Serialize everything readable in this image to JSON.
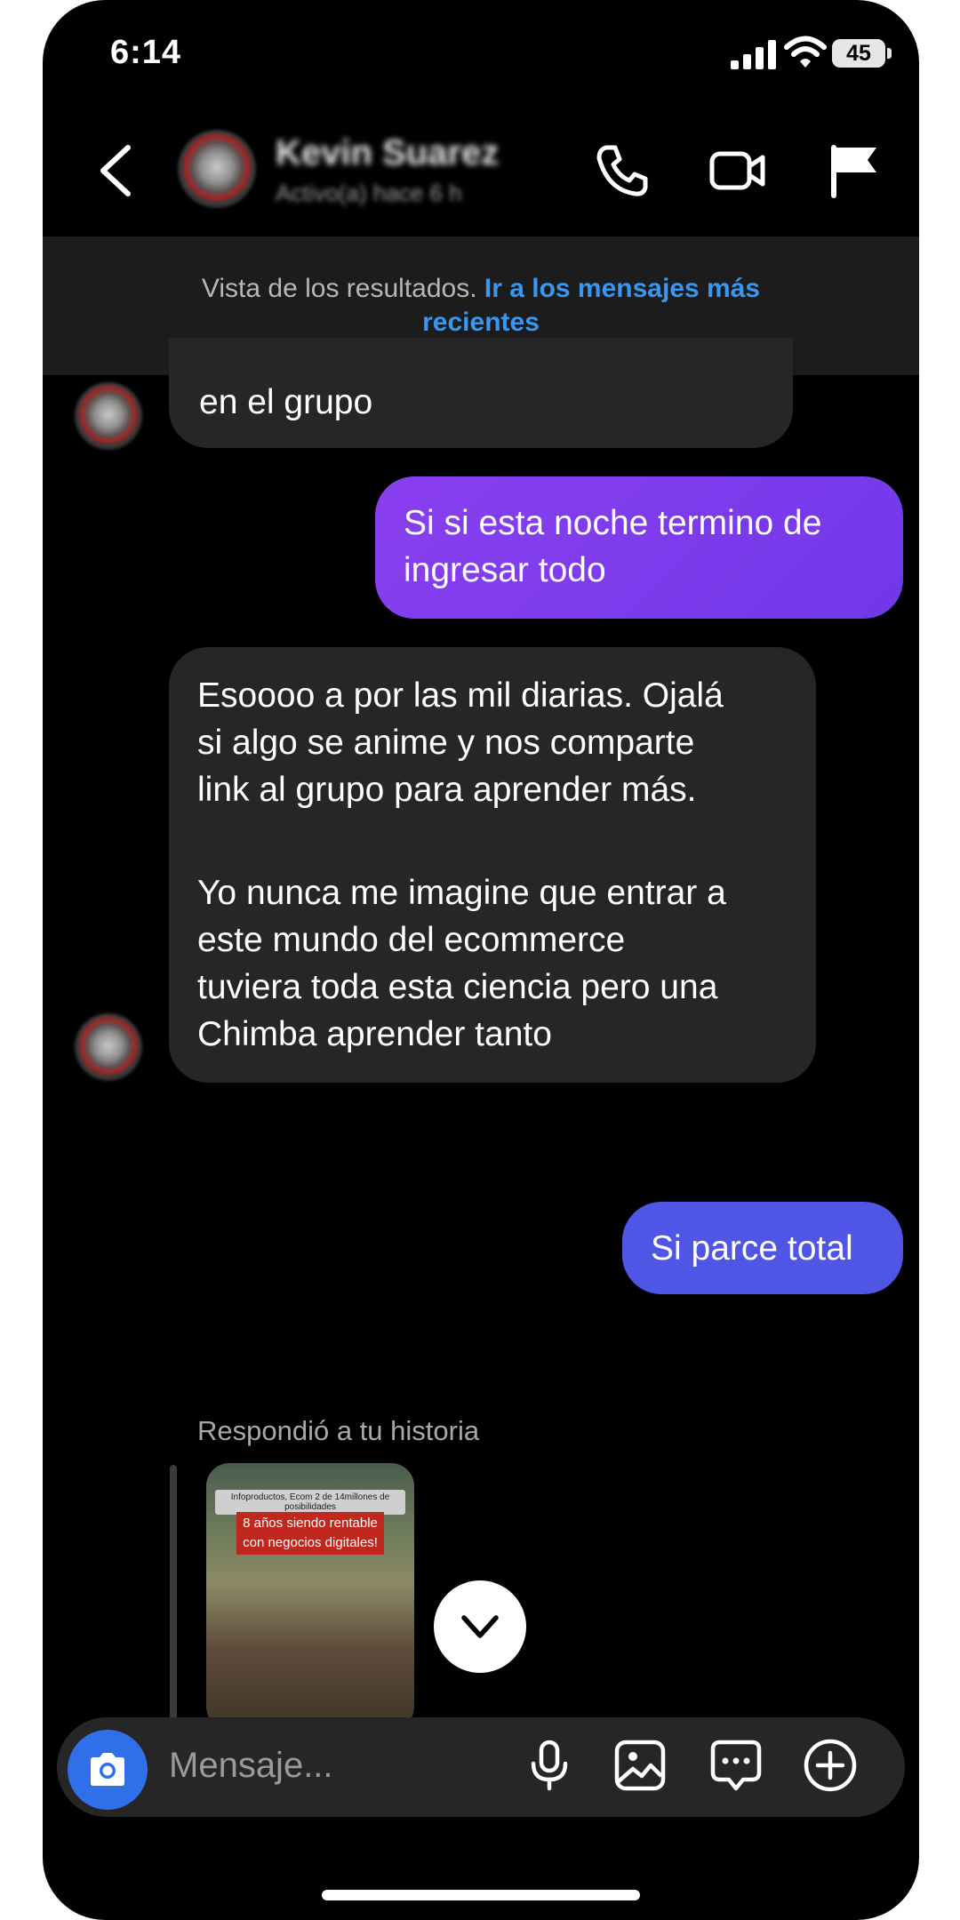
{
  "status_bar": {
    "time": "6:14",
    "battery": "45"
  },
  "header": {
    "contact_name": "Kevin Suarez",
    "contact_status": "Activo(a) hace 6 h",
    "icons": [
      "back-icon",
      "phone-icon",
      "video-icon",
      "flag-icon"
    ]
  },
  "banner": {
    "text": "Vista de los resultados.",
    "link": "Ir a los mensajes más recientes"
  },
  "messages": [
    {
      "direction": "incoming",
      "lines": [
        "en el grupo"
      ]
    },
    {
      "direction": "outgoing",
      "color": "#7c3aed",
      "lines": [
        "Si si esta noche termino de",
        "ingresar todo"
      ]
    },
    {
      "direction": "incoming",
      "lines": [
        "Esoooo a por las mil diarias. Ojalá",
        "si algo se anime y nos comparte",
        "link al grupo para aprender más.",
        "",
        "Yo nunca me imagine que entrar a",
        "este mundo del ecommerce",
        "tuviera toda esta ciencia pero una",
        "Chimba aprender tanto"
      ]
    },
    {
      "direction": "outgoing",
      "color": "#4f56e6",
      "lines": [
        "Si parce total"
      ]
    }
  ],
  "story_reply": {
    "label": "Respondió a tu historia",
    "top_text": "Infoproductos, Ecom 2 de 14millones de posibilidades",
    "red_text": "8 años siendo rentable con negocios digitales!"
  },
  "composer": {
    "placeholder": "Mensaje...",
    "icons": [
      "camera-icon",
      "microphone-icon",
      "image-icon",
      "chat-bubble-icon",
      "plus-circle-icon"
    ]
  },
  "colors": {
    "accent_link": "#3897f0",
    "incoming_bubble": "#262626",
    "camera_button": "#2f6fe8"
  }
}
